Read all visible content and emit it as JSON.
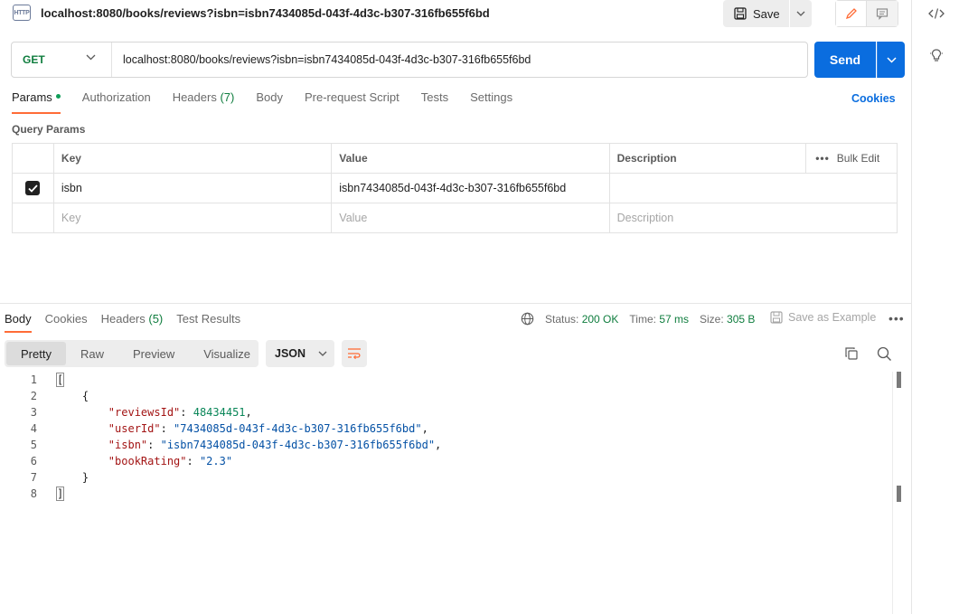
{
  "request": {
    "icon_label": "HTTP",
    "title": "localhost:8080/books/reviews?isbn=isbn7434085d-043f-4d3c-b307-316fb655f6bd",
    "save_label": "Save",
    "method": "GET",
    "url": "localhost:8080/books/reviews?isbn=isbn7434085d-043f-4d3c-b307-316fb655f6bd",
    "send_label": "Send"
  },
  "request_tabs": {
    "params": "Params",
    "authorization": "Authorization",
    "headers": "Headers",
    "headers_count": "(7)",
    "body": "Body",
    "prerequest": "Pre-request Script",
    "tests": "Tests",
    "settings": "Settings",
    "cookies": "Cookies"
  },
  "query_params": {
    "section_title": "Query Params",
    "columns": {
      "key": "Key",
      "value": "Value",
      "description": "Description",
      "bulk_edit": "Bulk Edit"
    },
    "rows": [
      {
        "key": "isbn",
        "value": "isbn7434085d-043f-4d3c-b307-316fb655f6bd",
        "description": "",
        "checked": true
      }
    ],
    "placeholders": {
      "key": "Key",
      "value": "Value",
      "description": "Description"
    }
  },
  "response": {
    "tabs": {
      "body": "Body",
      "cookies": "Cookies",
      "headers": "Headers",
      "headers_count": "(5)",
      "test_results": "Test Results"
    },
    "status_label": "Status:",
    "status_value": "200 OK",
    "time_label": "Time:",
    "time_value": "57 ms",
    "size_label": "Size:",
    "size_value": "305 B",
    "save_example": "Save as Example",
    "views": {
      "pretty": "Pretty",
      "raw": "Raw",
      "preview": "Preview",
      "visualize": "Visualize"
    },
    "format": "JSON",
    "body_lines": {
      "l1": {
        "num": "1",
        "text": "["
      },
      "l2": {
        "num": "2",
        "text": "{"
      },
      "l3": {
        "num": "3",
        "key": "\"reviewsId\"",
        "sep": ": ",
        "val": "48434451",
        "end": ","
      },
      "l4": {
        "num": "4",
        "key": "\"userId\"",
        "sep": ": ",
        "val": "\"7434085d-043f-4d3c-b307-316fb655f6bd\"",
        "end": ","
      },
      "l5": {
        "num": "5",
        "key": "\"isbn\"",
        "sep": ": ",
        "val": "\"isbn7434085d-043f-4d3c-b307-316fb655f6bd\"",
        "end": ","
      },
      "l6": {
        "num": "6",
        "key": "\"bookRating\"",
        "sep": ": ",
        "val": "\"2.3\"",
        "end": ""
      },
      "l7": {
        "num": "7",
        "text": "}"
      },
      "l8": {
        "num": "8",
        "text": "]"
      }
    }
  },
  "colors": {
    "accent": "#0a6ddf",
    "tab_indicator": "#ff6c37",
    "method_get": "#0f7d3e",
    "status_ok": "#0f7d3e"
  },
  "icons": {
    "save": "floppy-disk-icon",
    "edit": "pencil-icon",
    "comments": "comment-icon",
    "code": "code-icon",
    "bulb": "lightbulb-icon",
    "globe": "globe-icon",
    "copy": "copy-icon",
    "search": "search-icon",
    "wrap": "wrap-lines-icon"
  }
}
